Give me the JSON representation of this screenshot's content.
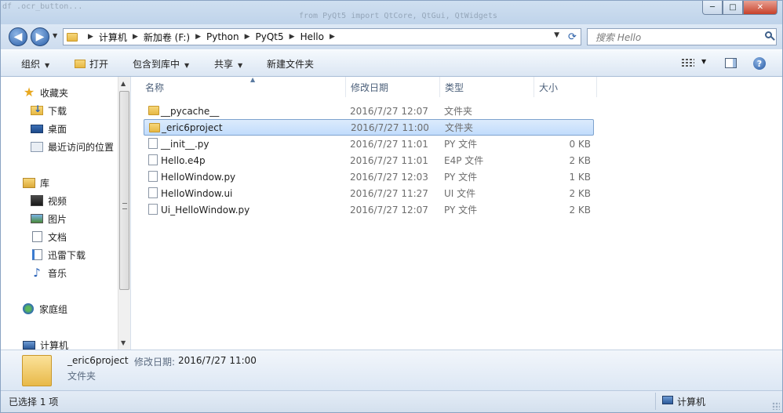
{
  "window": {
    "controls": {
      "minimize": "─",
      "maximize": "□",
      "close": "✕"
    }
  },
  "address": {
    "breadcrumbs": [
      "计算机",
      "新加卷 (F:)",
      "Python",
      "PyQt5",
      "Hello"
    ],
    "search_placeholder": "搜索 Hello"
  },
  "toolbar": {
    "organize": "组织",
    "open": "打开",
    "include_in_library": "包含到库中",
    "share": "共享",
    "new_folder": "新建文件夹"
  },
  "nav": {
    "favorites": {
      "header": "收藏夹",
      "items": [
        {
          "label": "下载",
          "icon": "downloads-icon"
        },
        {
          "label": "桌面",
          "icon": "desktop-icon"
        },
        {
          "label": "最近访问的位置",
          "icon": "recent-places-icon"
        }
      ]
    },
    "libraries": {
      "header": "库",
      "items": [
        {
          "label": "视频",
          "icon": "videos-icon"
        },
        {
          "label": "图片",
          "icon": "pictures-icon"
        },
        {
          "label": "文档",
          "icon": "documents-icon"
        },
        {
          "label": "迅雷下载",
          "icon": "xunlei-download-icon"
        },
        {
          "label": "音乐",
          "icon": "music-icon"
        }
      ]
    },
    "homegroup": "家庭组",
    "computer": "计算机"
  },
  "columns": {
    "name": "名称",
    "date": "修改日期",
    "type": "类型",
    "size": "大小"
  },
  "files": [
    {
      "name": "__pycache__",
      "date": "2016/7/27 12:07",
      "type": "文件夹",
      "size": "",
      "kind": "folder"
    },
    {
      "name": "_eric6project",
      "date": "2016/7/27 11:00",
      "type": "文件夹",
      "size": "",
      "kind": "folder",
      "selected": true
    },
    {
      "name": "__init__.py",
      "date": "2016/7/27 11:01",
      "type": "PY 文件",
      "size": "0 KB",
      "kind": "file"
    },
    {
      "name": "Hello.e4p",
      "date": "2016/7/27 11:01",
      "type": "E4P 文件",
      "size": "2 KB",
      "kind": "file"
    },
    {
      "name": "HelloWindow.py",
      "date": "2016/7/27 12:03",
      "type": "PY 文件",
      "size": "1 KB",
      "kind": "file"
    },
    {
      "name": "HelloWindow.ui",
      "date": "2016/7/27 11:27",
      "type": "UI 文件",
      "size": "2 KB",
      "kind": "file"
    },
    {
      "name": "Ui_HelloWindow.py",
      "date": "2016/7/27 12:07",
      "type": "PY 文件",
      "size": "2 KB",
      "kind": "file"
    }
  ],
  "details": {
    "name": "_eric6project",
    "date_label": "修改日期:",
    "date": "2016/7/27 11:00",
    "type": "文件夹"
  },
  "status": {
    "selection": "已选择 1 项",
    "location": "计算机"
  },
  "colors": {
    "selection_fill": "#cce4fc",
    "selection_border": "#7da2ce",
    "chrome": "#dce7f4"
  }
}
